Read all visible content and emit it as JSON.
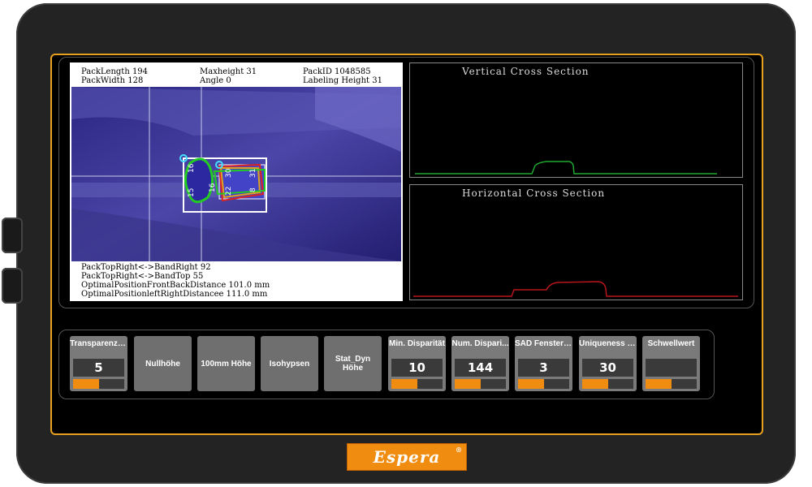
{
  "camera": {
    "top_lines": [
      [
        "PackLength 194",
        "Maxheight  31",
        "PackID 1048585"
      ],
      [
        "PackWidth 128",
        "Angle  0",
        "Labeling Height 31"
      ]
    ],
    "contour_labels": [
      "16",
      "15",
      "16",
      "30",
      "22",
      "31",
      "8"
    ],
    "bottom_lines": [
      "PackTopRight<->BandRight 92",
      "PackTopRight<->BandTop 55",
      "OptimalPositionFrontBackDistance 101.0 mm",
      "OptimalPositionleftRightDistancee 111.0 mm"
    ]
  },
  "vertical_section": {
    "title": "Vertical Cross Section",
    "color": "#1fa82f"
  },
  "horizontal_section": {
    "title": "Horizontal Cross Section",
    "color": "#b8151b"
  },
  "controls": [
    {
      "label": "Transparenzh...",
      "value": "5",
      "level": 0.5
    },
    {
      "label": "Nullhöhe"
    },
    {
      "label": "100mm Höhe"
    },
    {
      "label": "Isohypsen"
    },
    {
      "label": "Stat_Dyn Höhe"
    },
    {
      "label": "Min. Disparität",
      "value": "10",
      "level": 0.5
    },
    {
      "label": "Num. Dispari...",
      "value": "144",
      "level": 0.5
    },
    {
      "label": "SAD Fensterg...",
      "value": "3",
      "level": 0.5
    },
    {
      "label": "Uniqueness R...",
      "value": "30",
      "level": 0.5
    },
    {
      "label": "Schwellwert",
      "value": "",
      "level": 0.5
    }
  ],
  "brand": {
    "logo": "Espera",
    "mark": "®",
    "accent": "#f08c10"
  }
}
